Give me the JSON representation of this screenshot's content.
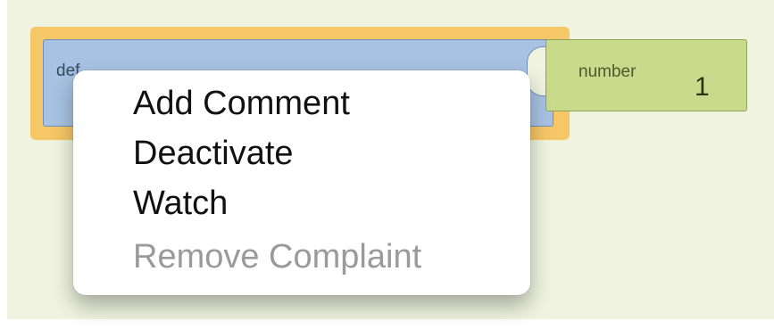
{
  "workspace": {
    "def_block": {
      "label": "def",
      "name": "variable"
    },
    "number_block": {
      "label": "number",
      "value": "1"
    }
  },
  "context_menu": {
    "items": [
      {
        "label": "Add Comment",
        "enabled": true
      },
      {
        "label": "Deactivate",
        "enabled": true
      },
      {
        "label": "Watch",
        "enabled": true
      },
      {
        "label": "Remove Complaint",
        "enabled": false
      }
    ]
  },
  "colors": {
    "workspace_bg": "#eff3df",
    "selection_glow": "#f5c766",
    "def_block": "#a7c2e3",
    "number_block": "#c9da8c",
    "disabled_text": "#9a9a9a"
  }
}
